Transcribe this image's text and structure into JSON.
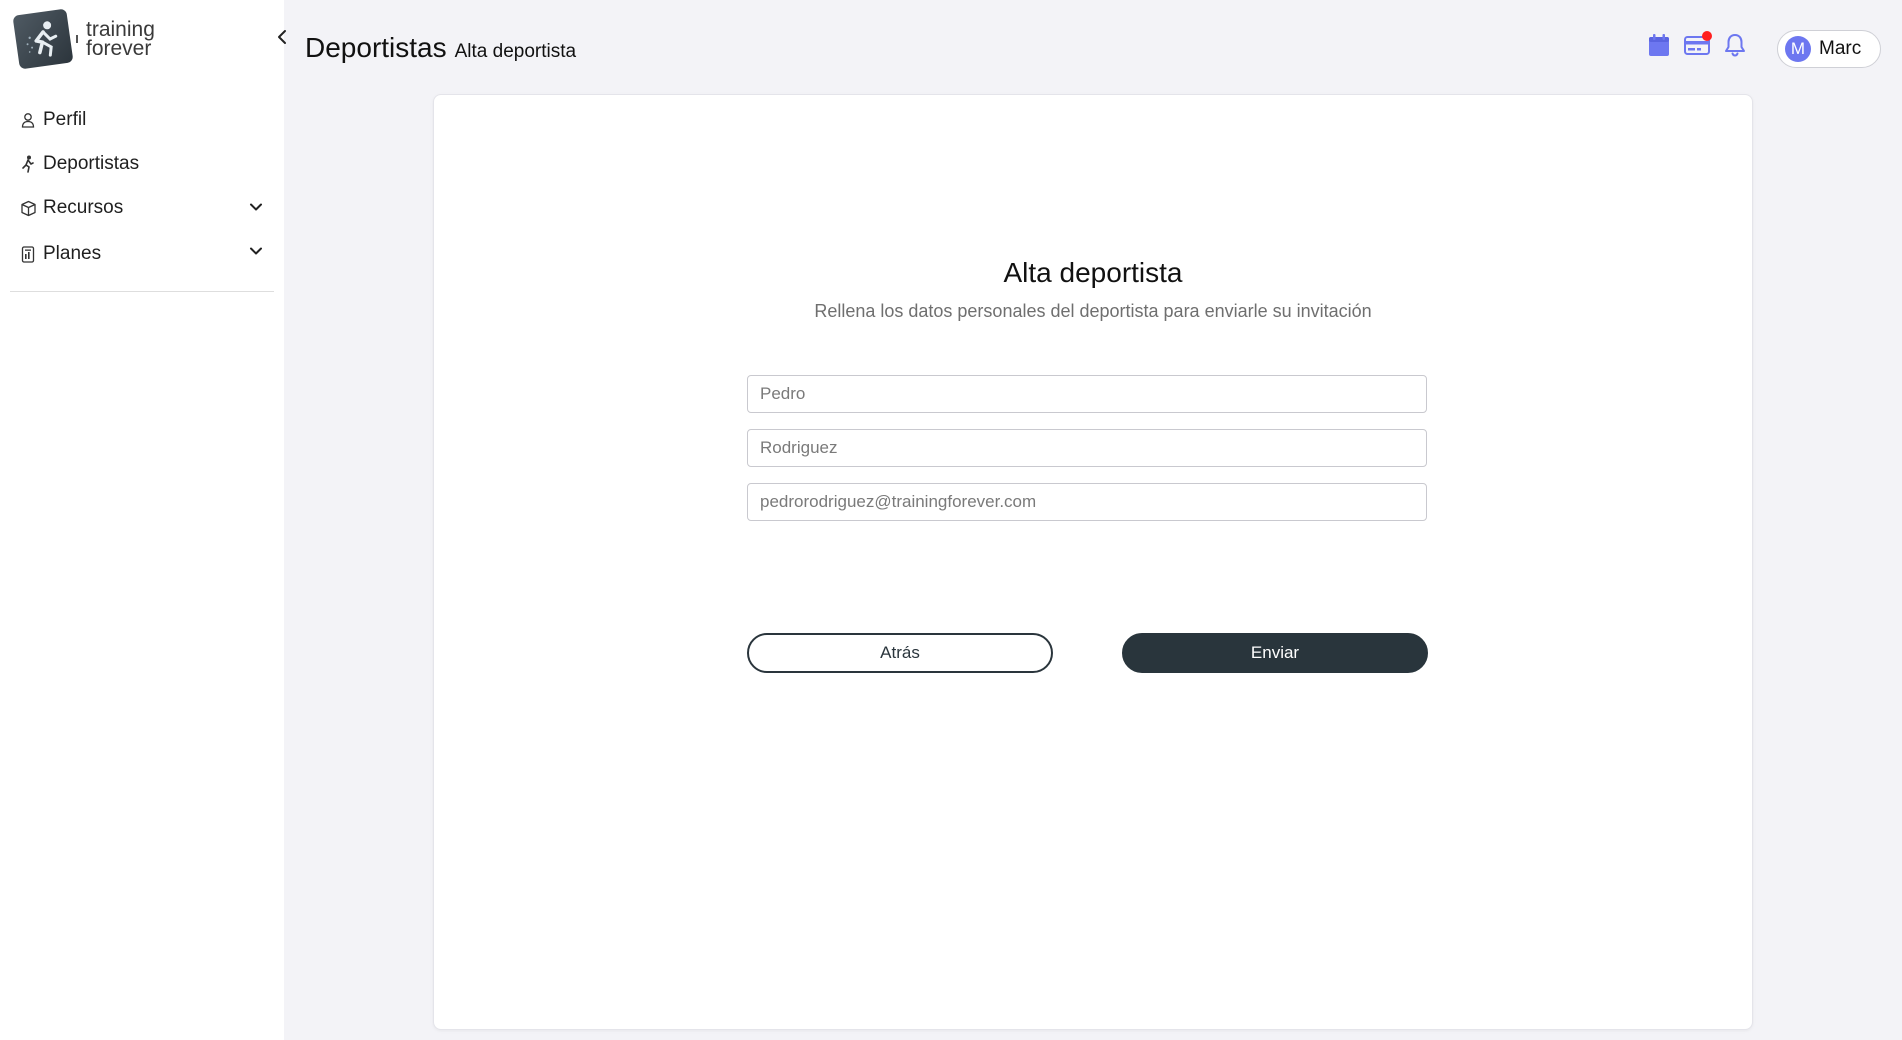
{
  "brand": {
    "line1": "training",
    "line2": "forever"
  },
  "sidebar": {
    "items": [
      {
        "label": "Perfil",
        "icon": "user-icon"
      },
      {
        "label": "Deportistas",
        "icon": "runner-icon"
      },
      {
        "label": "Recursos",
        "icon": "box-icon",
        "expandable": true
      },
      {
        "label": "Planes",
        "icon": "calculator-icon",
        "expandable": true
      }
    ]
  },
  "header": {
    "title": "Deportistas",
    "subtitle": "Alta deportista",
    "icons": [
      "calendar-icon",
      "card-icon",
      "bell-icon"
    ],
    "user": {
      "initial": "M",
      "name": "Marc"
    }
  },
  "form": {
    "title": "Alta deportista",
    "description": "Rellena los datos personales del deportista para enviarle su invitación",
    "fields": [
      {
        "placeholder": "Pedro"
      },
      {
        "placeholder": "Rodriguez"
      },
      {
        "placeholder": "pedrorodriguez@trainingforever.com"
      }
    ],
    "back_label": "Atrás",
    "submit_label": "Enviar"
  },
  "colors": {
    "accent": "#6d77f0",
    "dark_button": "#29353c",
    "notification_dot": "#ff1f1f",
    "background": "#f3f3f7"
  }
}
